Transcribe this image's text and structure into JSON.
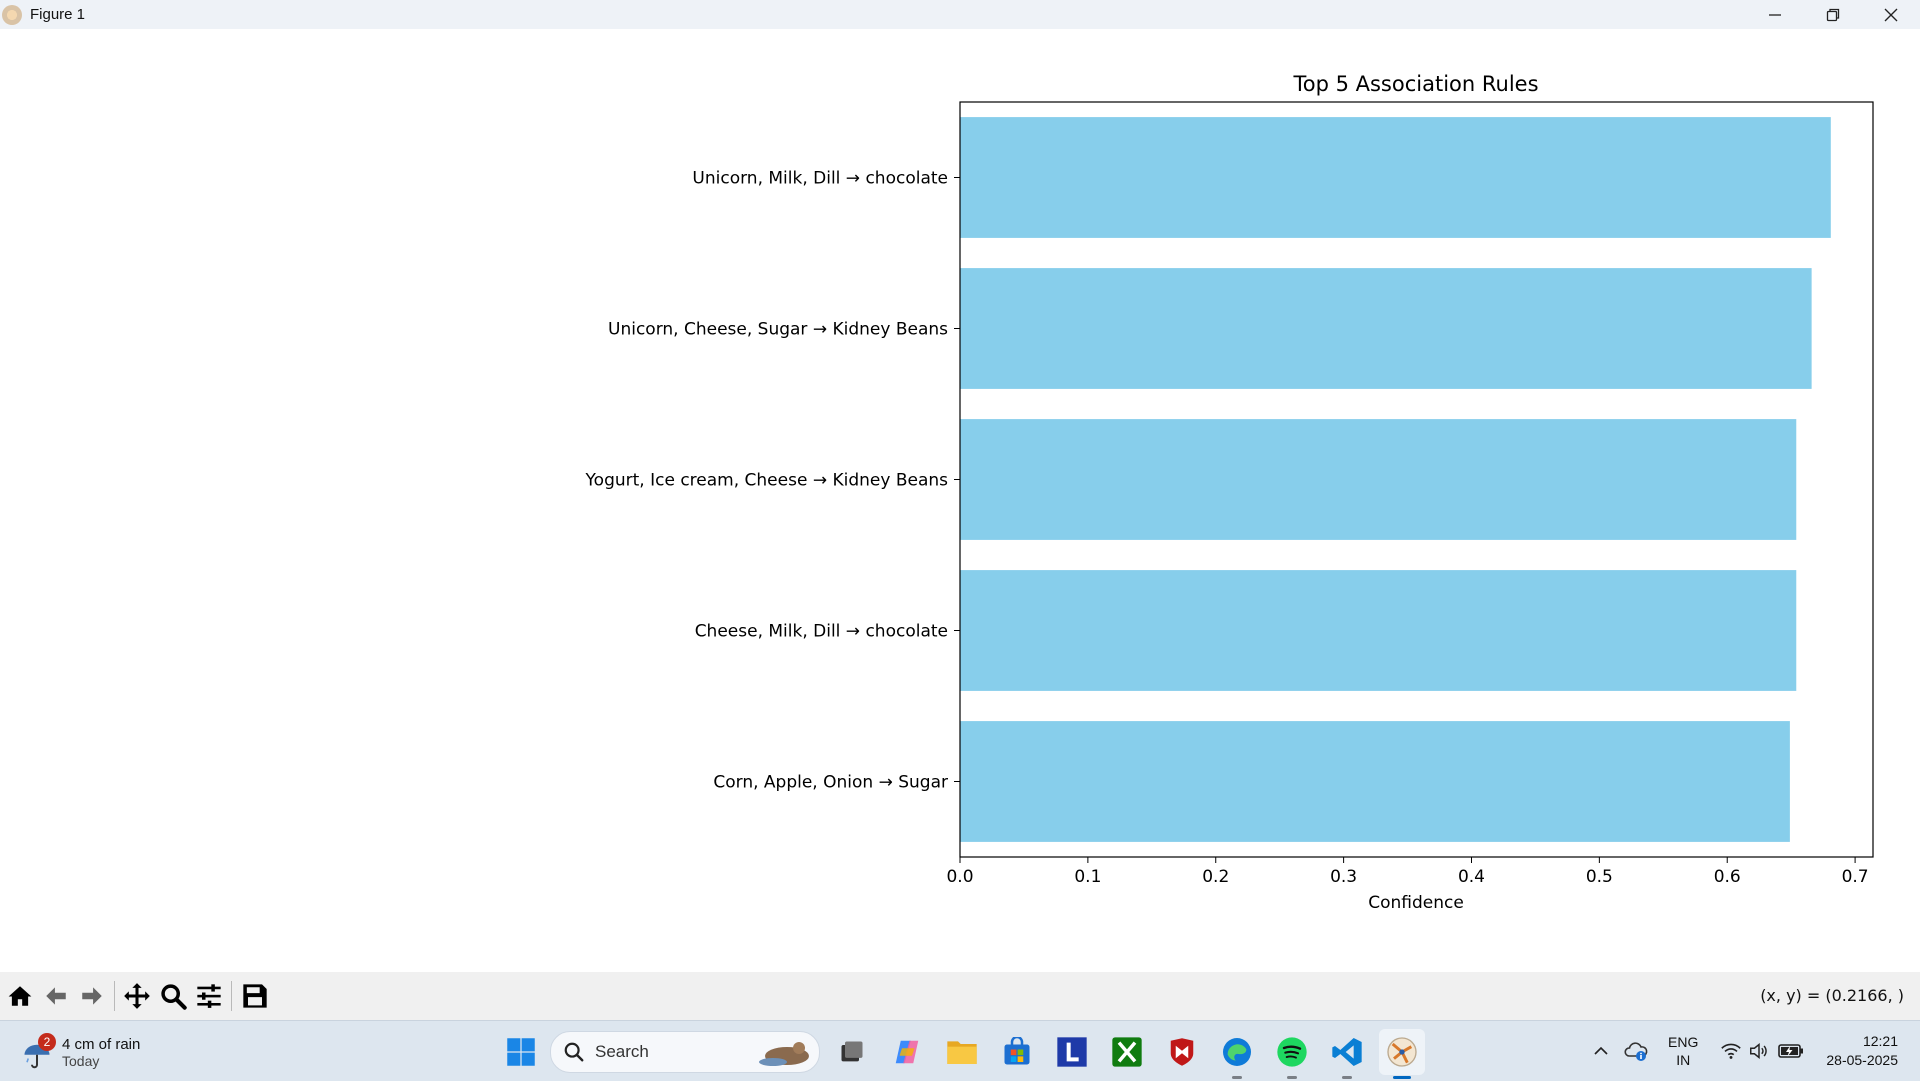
{
  "window": {
    "title": "Figure 1"
  },
  "chart_data": {
    "type": "bar",
    "orientation": "horizontal",
    "title": "Top 5 Association Rules",
    "xlabel": "Confidence",
    "ylabel": "",
    "categories": [
      "Unicorn, Milk, Dill → chocolate",
      "Unicorn, Cheese, Sugar → Kidney Beans",
      "Yogurt, Ice cream, Cheese → Kidney Beans",
      "Cheese, Milk, Dill → chocolate",
      "Corn, Apple, Onion → Sugar"
    ],
    "values": [
      0.681,
      0.666,
      0.654,
      0.654,
      0.649
    ],
    "xlim": [
      0,
      0.714
    ],
    "xticks": [
      "0.0",
      "0.1",
      "0.2",
      "0.3",
      "0.4",
      "0.5",
      "0.6",
      "0.7"
    ],
    "xtick_values": [
      0,
      0.1,
      0.2,
      0.3,
      0.4,
      0.5,
      0.6,
      0.7
    ],
    "bar_color": "#87ceeb",
    "grid": false,
    "legend": "none"
  },
  "toolbar": {
    "coords": "(x, y) = (0.2166, )"
  },
  "taskbar": {
    "weather_badge": "2",
    "weather_main": "4 cm of rain",
    "weather_sub": "Today",
    "search_placeholder": "Search",
    "lang_top": "ENG",
    "lang_bottom": "IN",
    "time": "12:21",
    "date": "28-05-2025"
  },
  "colors": {
    "titlebar_bg": "#eef2f7",
    "taskbar_bg": "#dde6ef",
    "toolbar_bg": "#f0f0f0",
    "accent": "#0067c0"
  }
}
